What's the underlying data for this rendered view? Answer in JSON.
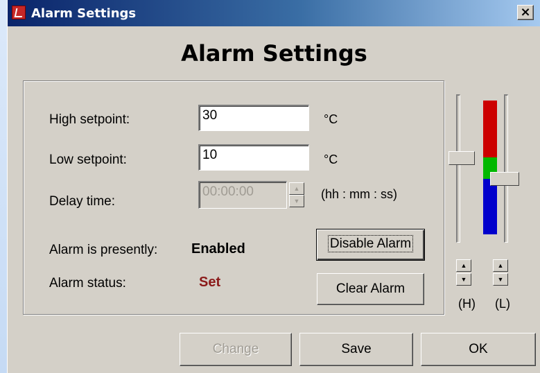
{
  "window": {
    "title": "Alarm Settings",
    "close_glyph": "×",
    "icon": "app-alarm-icon"
  },
  "heading": "Alarm Settings",
  "fields": {
    "high": {
      "label": "High setpoint:",
      "value": "30",
      "unit": "°C"
    },
    "low": {
      "label": "Low setpoint:",
      "value": "10",
      "unit": "°C"
    },
    "delay": {
      "label": "Delay time:",
      "value": "00:00:00",
      "unit": "(hh : mm : ss)"
    }
  },
  "status": {
    "presently_label": "Alarm is presently:",
    "presently_value": "Enabled",
    "status_label": "Alarm status:",
    "status_value": "Set",
    "status_color": "#8b1a1a"
  },
  "buttons": {
    "disable_alarm": "Disable Alarm",
    "clear_alarm": "Clear Alarm",
    "change": "Change",
    "save": "Save",
    "ok": "OK"
  },
  "range_indicator": {
    "colors": {
      "high_zone": "#cc0000",
      "normal_zone": "#00b800",
      "low_zone": "#0000cc"
    },
    "high_slider_label": "(H)",
    "low_slider_label": "(L)",
    "arrow_up": "▲",
    "arrow_down": "▼"
  }
}
